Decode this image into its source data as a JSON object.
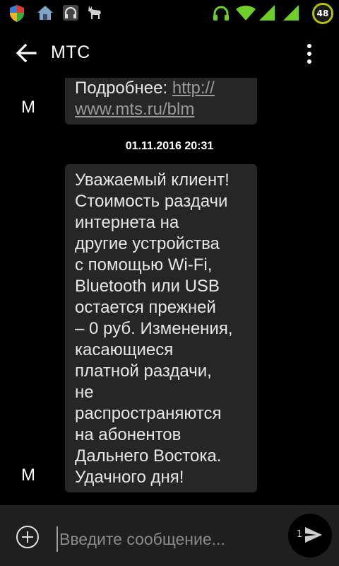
{
  "status_bar": {
    "battery_level": "48",
    "icons": [
      "shield-icon",
      "home-icon",
      "headphones-app-icon",
      "deer-icon",
      "headset-icon",
      "wifi-icon",
      "signal-icon",
      "signal-icon-2",
      "battery-icon"
    ],
    "accent": "#7bd12a"
  },
  "toolbar": {
    "title": "МТС"
  },
  "messages": [
    {
      "avatar": "M",
      "line1_prefix": "Подробнее: ",
      "line1_link": "http://",
      "line2_link": "www.mts.ru/blm"
    }
  ],
  "timestamp": "01.11.2016 20:31",
  "message2": {
    "avatar": "M",
    "lines": [
      "Уважаемый клиент!",
      "Стоимость раздачи",
      "интернета на",
      "другие устройства",
      "с помощью Wi-Fi,",
      "Bluetooth или USB",
      "остается прежней",
      "– 0 руб. Изменения,",
      "касающиеся",
      "платной раздачи,",
      "не",
      "распространяются",
      "на абонентов",
      "Дальнего Востока.",
      "Удачного дня!"
    ]
  },
  "compose": {
    "placeholder": "Введите сообщение...",
    "send_count": "1"
  },
  "colors": {
    "background": "#000000",
    "bubble": "#262626",
    "compose_bar": "#1f1f1f"
  }
}
